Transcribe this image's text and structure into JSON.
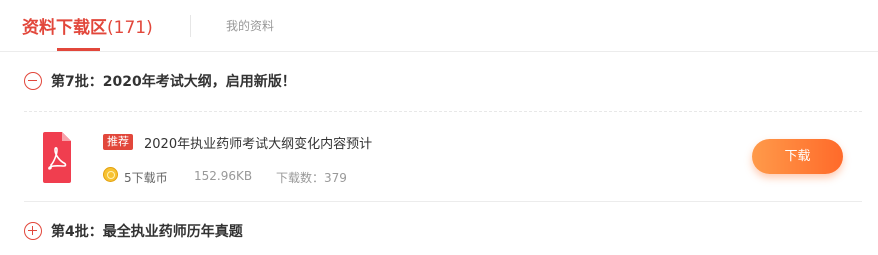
{
  "tabs": {
    "active_label": "资料下载区",
    "active_count": "(171)",
    "other_label": "我的资料"
  },
  "batches": [
    {
      "title": "第7批：2020年考试大纲，启用新版！",
      "expanded": true
    },
    {
      "title": "第4批：最全执业药师历年真题",
      "expanded": false
    }
  ],
  "file": {
    "tag": "推荐",
    "title": "2020年执业药师考试大纲变化内容预计",
    "cost": "5下载币",
    "size": "152.96KB",
    "downloads": "下载数：379",
    "download_button": "下载",
    "icon": "pdf-file-icon"
  },
  "colors": {
    "accent": "#e2473b",
    "button_start": "#ff9a4a",
    "button_end": "#ff6a2a"
  }
}
